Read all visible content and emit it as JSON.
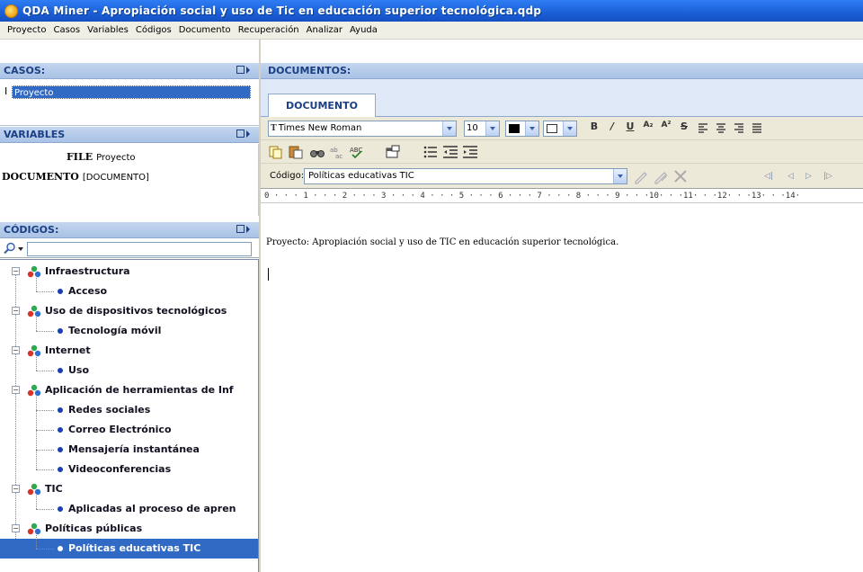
{
  "window": {
    "title": "QDA Miner - Apropiación social y uso de Tic en educación superior tecnológica.qdp"
  },
  "menu": [
    "Proyecto",
    "Casos",
    "Variables",
    "Códigos",
    "Documento",
    "Recuperación",
    "Analizar",
    "Ayuda"
  ],
  "panels": {
    "casos": {
      "title": "CASOS:",
      "cursor": "I",
      "selected_case": "Proyecto"
    },
    "variables": {
      "title": "VARIABLES",
      "rows": [
        {
          "name": "FILE",
          "value": "Proyecto"
        },
        {
          "name": "DOCUMENTO",
          "value": "[DOCUMENTO]"
        }
      ]
    },
    "codigos": {
      "title": "CÓDIGOS:",
      "tree": [
        {
          "label": "Infraestructura",
          "children": [
            "Acceso"
          ]
        },
        {
          "label": "Uso de dispositivos tecnológicos",
          "children": [
            "Tecnología móvil"
          ]
        },
        {
          "label": "Internet",
          "children": [
            "Uso"
          ]
        },
        {
          "label": "Aplicación de herramientas de Inf",
          "children": [
            "Redes sociales",
            "Correo Electrónico",
            "Mensajería instantánea",
            "Videoconferencias"
          ]
        },
        {
          "label": "TIC",
          "children": [
            "Aplicadas al proceso de apren"
          ]
        },
        {
          "label": "Políticas públicas",
          "children": [
            "Políticas educativas TIC"
          ]
        }
      ],
      "selected_code": "Políticas educativas TIC"
    }
  },
  "documents": {
    "header": "DOCUMENTOS:",
    "tab": "DOCUMENTO",
    "font_name": "Times New Roman",
    "font_size": "10",
    "code_label": "Código:",
    "code_value": "Políticas educativas TIC",
    "ruler": "0 · · · 1 · · · 2 · · · 3 · · · 4 · · · 5 · · · 6 · · · 7 · · · 8 · · · 9 · · ·10· · ·11· · ·12· · ·13· · ·14·",
    "text": "Proyecto: Apropiación social y uso de TIC en educación superior tecnológica."
  },
  "colors": {
    "titlebar": "#1a5fd6",
    "panel_header": "#a9c2e6",
    "selection": "#316ac5"
  }
}
